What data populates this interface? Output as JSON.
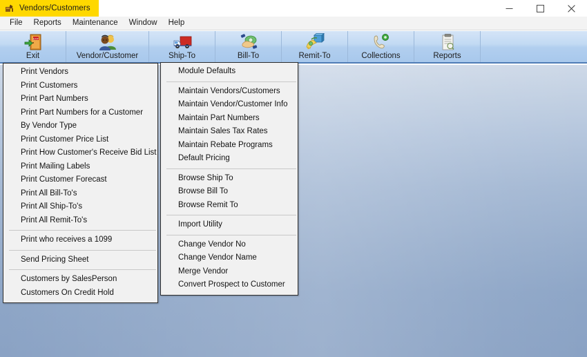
{
  "window": {
    "title": "Vendors/Customers",
    "icon": "app-icon",
    "controls": [
      {
        "name": "minimize",
        "glyph": "minimize-icon"
      },
      {
        "name": "maximize",
        "glyph": "maximize-icon"
      },
      {
        "name": "close",
        "glyph": "close-icon"
      }
    ]
  },
  "menubar": {
    "items": [
      {
        "label": "File"
      },
      {
        "label": "Reports"
      },
      {
        "label": "Maintenance"
      },
      {
        "label": "Window"
      },
      {
        "label": "Help"
      }
    ]
  },
  "toolbar": {
    "buttons": [
      {
        "label": "Exit",
        "icon": "exit-door-icon"
      },
      {
        "label": "Vendor/Customer",
        "icon": "people-icon"
      },
      {
        "label": "Ship-To",
        "icon": "truck-icon"
      },
      {
        "label": "Bill-To",
        "icon": "hand-money-icon"
      },
      {
        "label": "Remit-To",
        "icon": "package-payment-icon"
      },
      {
        "label": "Collections",
        "icon": "phone-icon"
      },
      {
        "label": "Reports",
        "icon": "clipboard-icon"
      }
    ]
  },
  "menus": {
    "reports": {
      "name": "Reports",
      "groups": [
        {
          "items": [
            {
              "label": "Print Vendors"
            },
            {
              "label": "Print Customers"
            },
            {
              "label": "Print Part Numbers"
            },
            {
              "label": "Print Part Numbers for a Customer"
            },
            {
              "label": "By Vendor Type"
            },
            {
              "label": "Print Customer Price List"
            },
            {
              "label": "Print How Customer's Receive Bid List"
            },
            {
              "label": "Print Mailing Labels"
            },
            {
              "label": "Print Customer Forecast"
            },
            {
              "label": "Print All Bill-To's"
            },
            {
              "label": "Print All Ship-To's"
            },
            {
              "label": "Print All Remit-To's"
            }
          ]
        },
        {
          "items": [
            {
              "label": "Print who receives a 1099"
            }
          ]
        },
        {
          "items": [
            {
              "label": "Send Pricing Sheet"
            }
          ]
        },
        {
          "items": [
            {
              "label": "Customers by SalesPerson"
            },
            {
              "label": "Customers On Credit Hold"
            }
          ]
        }
      ]
    },
    "maintenance": {
      "name": "Maintenance",
      "groups": [
        {
          "items": [
            {
              "label": "Module Defaults"
            }
          ]
        },
        {
          "items": [
            {
              "label": "Maintain Vendors/Customers"
            },
            {
              "label": "Maintain Vendor/Customer Info"
            },
            {
              "label": "Maintain Part Numbers"
            },
            {
              "label": "Maintain Sales Tax Rates"
            },
            {
              "label": "Maintain Rebate Programs"
            },
            {
              "label": "Default Pricing"
            }
          ]
        },
        {
          "items": [
            {
              "label": "Browse Ship To"
            },
            {
              "label": "Browse Bill To"
            },
            {
              "label": "Browse Remit To"
            }
          ]
        },
        {
          "items": [
            {
              "label": "Import Utility"
            }
          ]
        },
        {
          "items": [
            {
              "label": "Change Vendor No"
            },
            {
              "label": "Change Vendor Name"
            },
            {
              "label": "Merge Vendor"
            },
            {
              "label": "Convert Prospect to Customer"
            }
          ]
        }
      ]
    }
  },
  "colors": {
    "title_tab_bg": "#ffd800",
    "toolbar_top": "#d4e4f7",
    "toolbar_bottom": "#a8c8ec",
    "toolbar_border": "#4f7cb5",
    "desktop_top": "#ced9e8",
    "desktop_bottom": "#8aa2c4",
    "menu_bg": "#f1f1f1",
    "menu_border": "#2c2c2c"
  }
}
